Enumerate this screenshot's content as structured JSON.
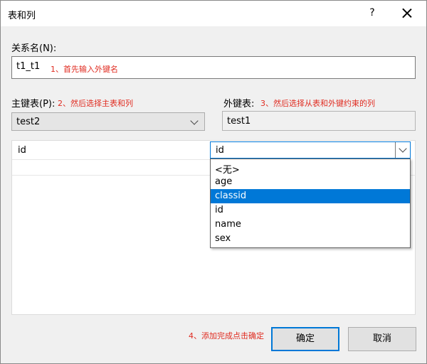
{
  "window": {
    "title": "表和列",
    "help_label": "?"
  },
  "relation_name": {
    "label": "关系名(N):",
    "value": "t1_t1",
    "annotation": "1、首先输入外键名"
  },
  "primary_table": {
    "label": "主键表(P):",
    "annotation": "2、然后选择主表和列",
    "value": "test2"
  },
  "foreign_table": {
    "label": "外键表:",
    "annotation": "3、然后选择从表和外键约束的列",
    "value": "test1"
  },
  "grid": {
    "primary_column": "id",
    "foreign_column": "id",
    "options": [
      "<无>",
      "age",
      "classid",
      "id",
      "name",
      "sex"
    ],
    "selected": "classid"
  },
  "footer": {
    "annotation": "4、添加完成点击确定",
    "ok_label": "确定",
    "cancel_label": "取消"
  },
  "colors": {
    "annotation": "#e02b20",
    "accent": "#0078d7"
  }
}
